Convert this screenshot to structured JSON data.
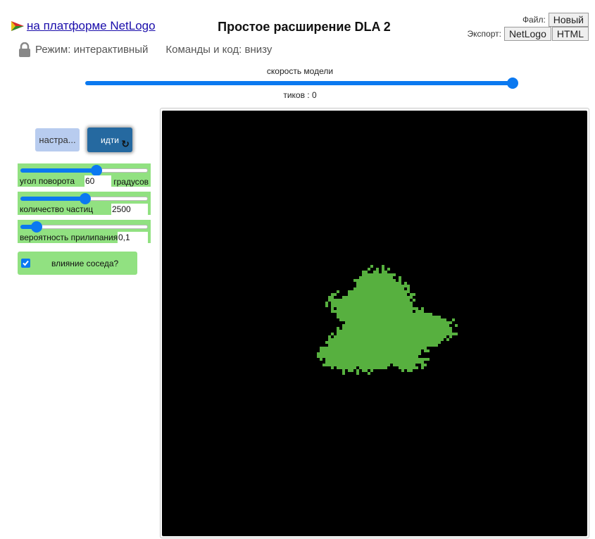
{
  "header": {
    "netlogo_link": "на платформе NetLogo",
    "title": "Простое расширение DLA 2",
    "mode_label": "Режим: интерактивный",
    "code_toggle": "Команды и код: внизу",
    "file_label": "Файл:",
    "new_button": "Новый",
    "export_label": "Экспорт:",
    "export_netlogo": "NetLogo",
    "export_html": "HTML"
  },
  "speed": {
    "label": "скорость модели",
    "value": 1.0
  },
  "ticks_text": "тиков : 0",
  "buttons": {
    "setup": "настра...",
    "go": "идти",
    "go_forever_icon": "forever-icon"
  },
  "sliders": [
    {
      "name": "угол поворота",
      "value": "60",
      "units": "градусов",
      "fraction": 0.6
    },
    {
      "name": "количество частиц",
      "value": "2500",
      "units": "",
      "fraction": 0.5
    },
    {
      "name": "вероятность прилипания",
      "value": "0,1",
      "units": "",
      "fraction": 0.1
    }
  ],
  "switch": {
    "label": "влияние соседа?",
    "checked": true
  },
  "view": {
    "background": "#000000",
    "cluster_color": "#57b03f"
  },
  "colors": {
    "accent_blue": "#0b79f0",
    "widget_green": "#91e181",
    "go_button": "#2569a0",
    "setup_button": "#b8ccef"
  }
}
